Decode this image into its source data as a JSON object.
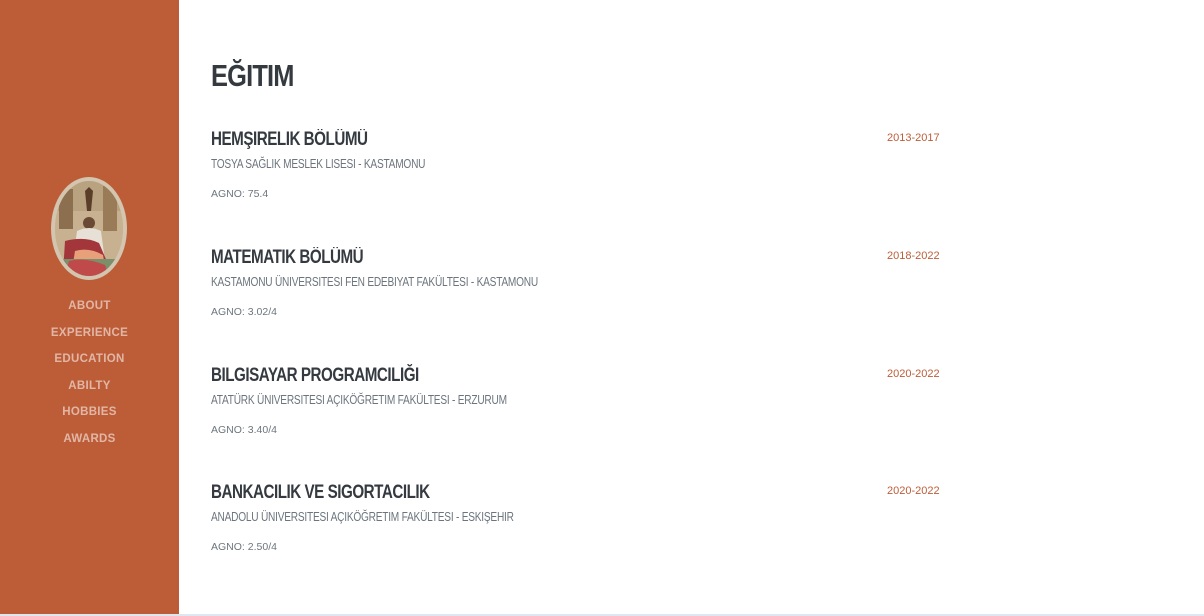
{
  "sidebar": {
    "nav": [
      {
        "label": "ABOUT"
      },
      {
        "label": "EXPERIENCE"
      },
      {
        "label": "EDUCATION"
      },
      {
        "label": "ABILTY"
      },
      {
        "label": "HOBBIES"
      },
      {
        "label": "AWARDS"
      }
    ]
  },
  "colors": {
    "sidebar_bg": "#bd5d38",
    "accent": "#bd5d38",
    "heading": "#343a40",
    "muted": "#6c757d"
  },
  "main": {
    "title": "EĞITIM",
    "entries": [
      {
        "degree": "HEMŞIRELIK BÖLÜMÜ",
        "school": "TOSYA SAĞLIK MESLEK LISESI - KASTAMONU",
        "grade": "AGNO: 75.4",
        "date": "2013-2017"
      },
      {
        "degree": "MATEMATIK BÖLÜMÜ",
        "school": "KASTAMONU ÜNIVERSITESI FEN EDEBIYAT FAKÜLTESI - KASTAMONU",
        "grade": "AGNO: 3.02/4",
        "date": "2018-2022"
      },
      {
        "degree": "BILGISAYAR PROGRAMCILIĞI",
        "school": "ATATÜRK ÜNIVERSITESI AÇIKÖĞRETIM FAKÜLTESI - ERZURUM",
        "grade": "AGNO: 3.40/4",
        "date": "2020-2022"
      },
      {
        "degree": "BANKACILIK VE SIGORTACILIK",
        "school": "ANADOLU ÜNIVERSITESI AÇIKÖĞRETIM FAKÜLTESI - ESKIŞEHIR",
        "grade": "AGNO: 2.50/4",
        "date": "2020-2022"
      }
    ]
  }
}
